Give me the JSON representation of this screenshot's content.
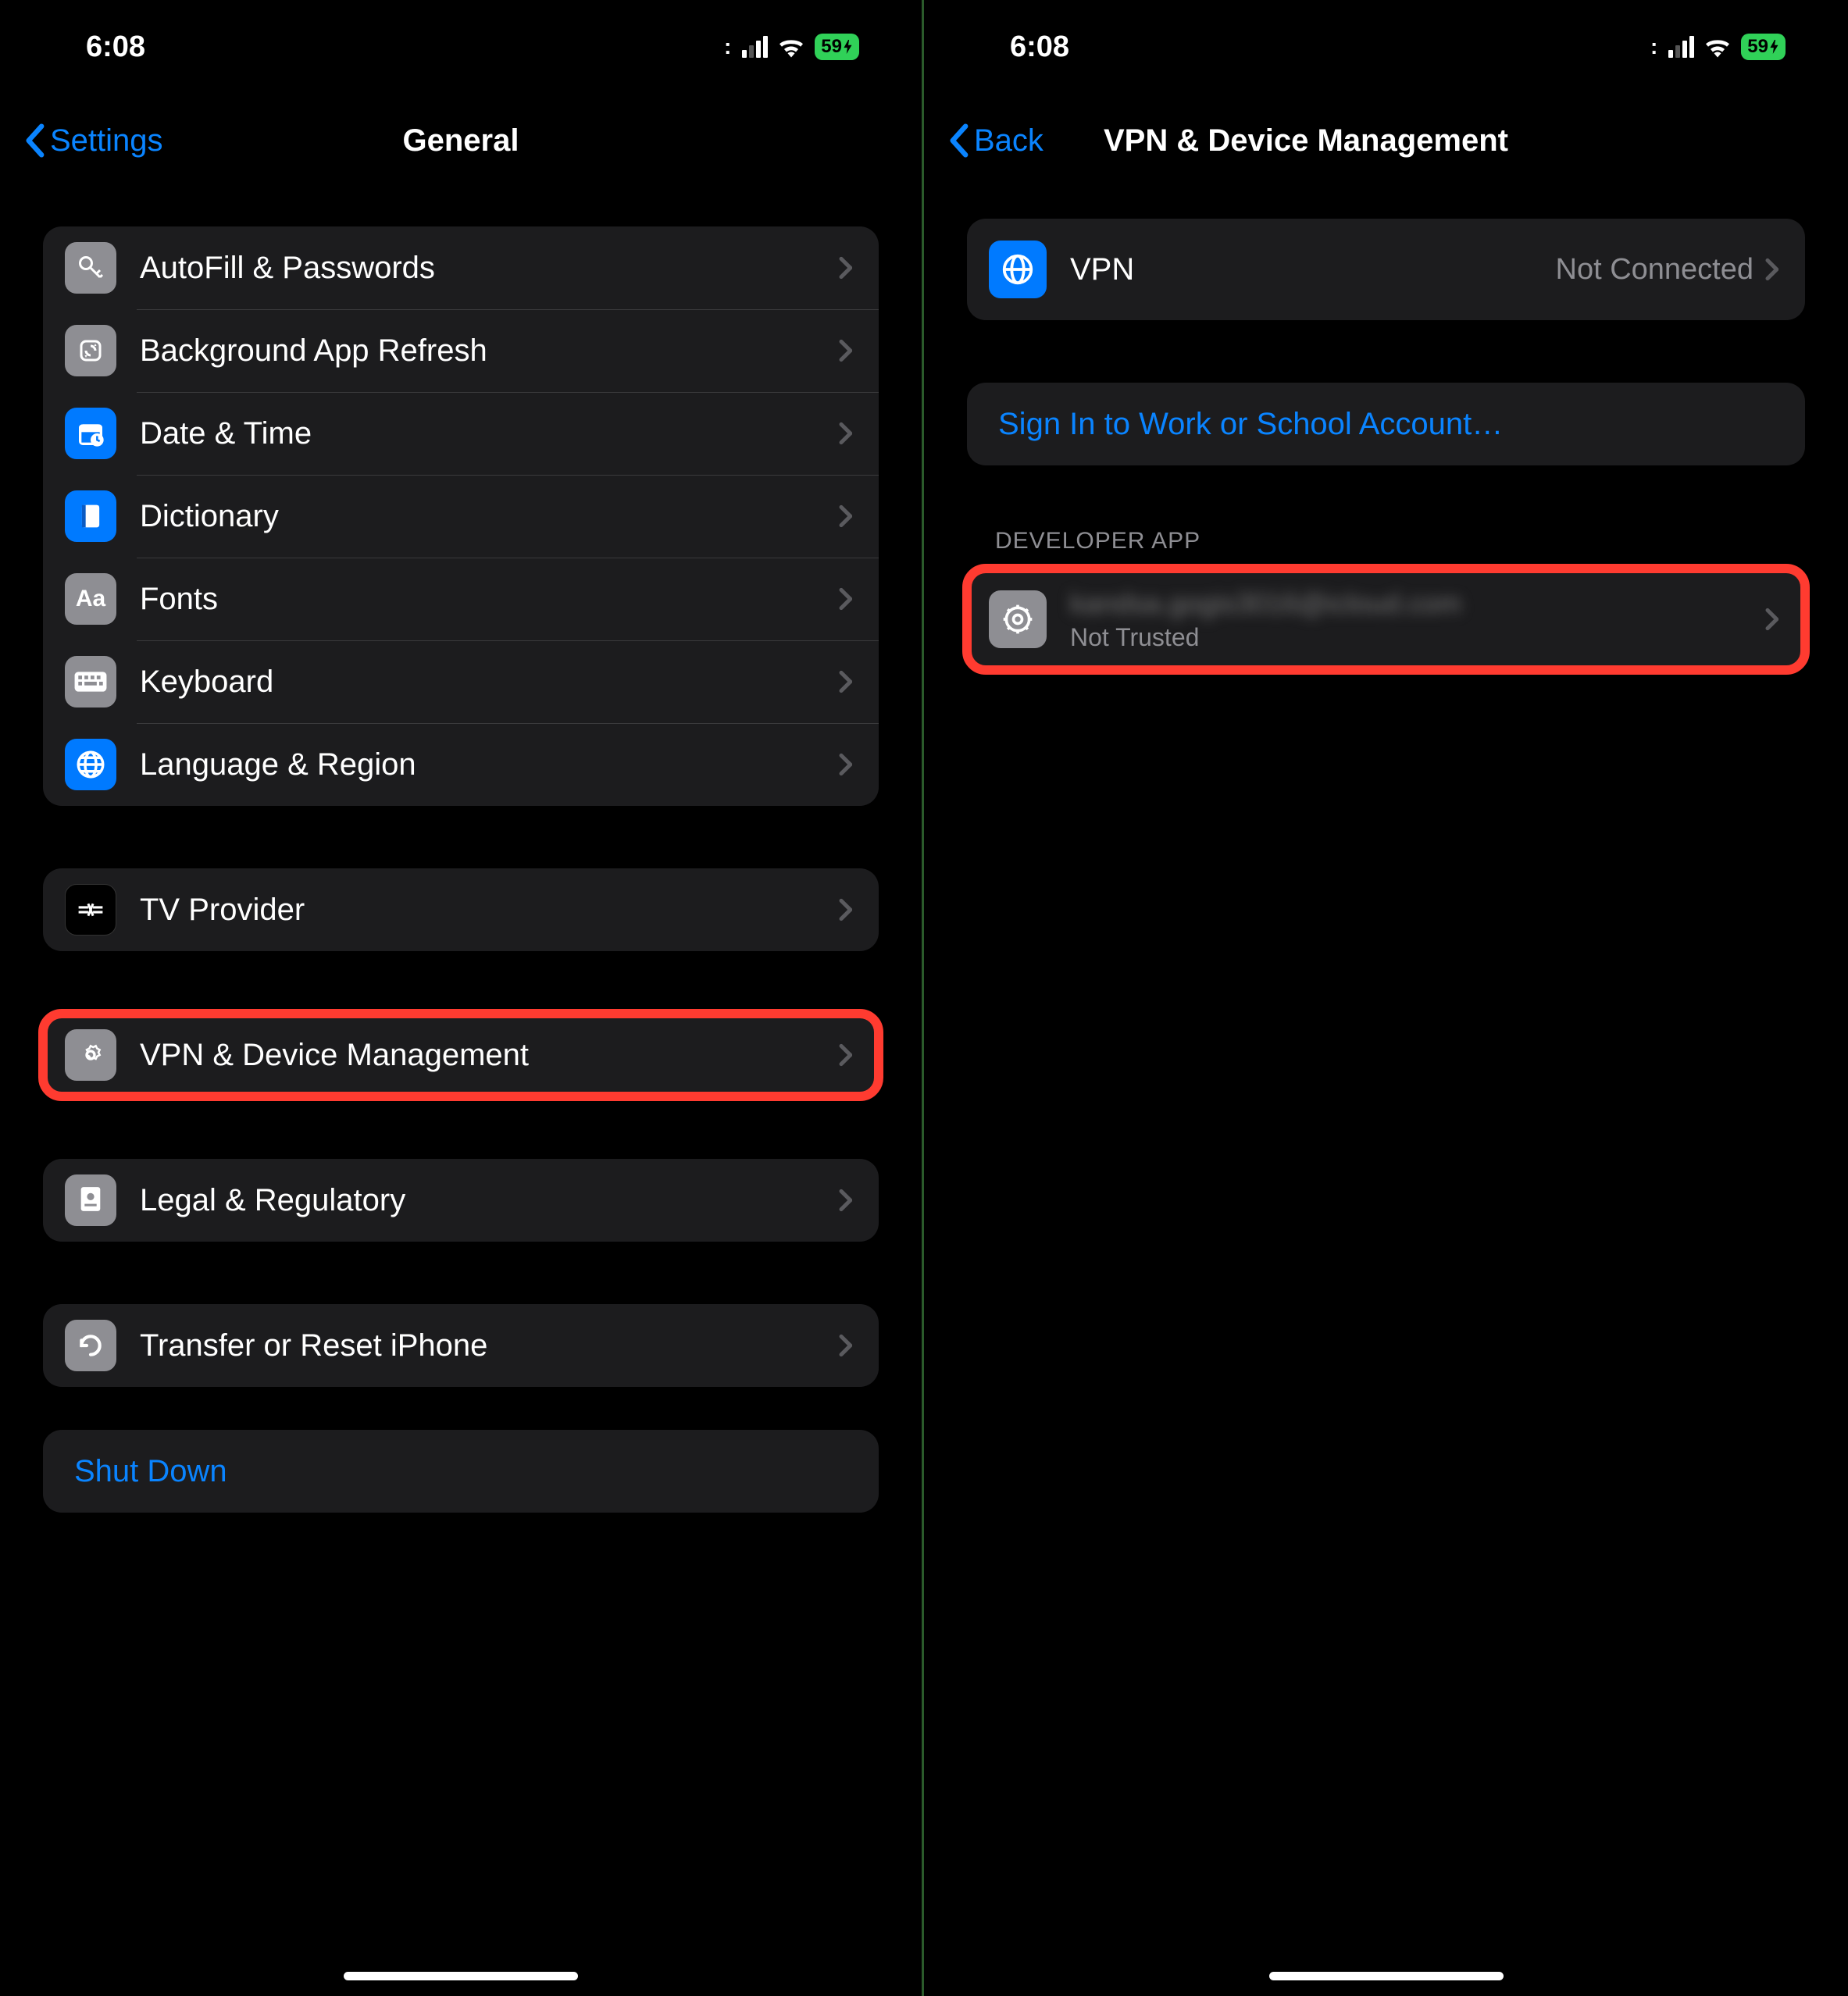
{
  "status": {
    "time": "6:08",
    "battery": "59"
  },
  "left": {
    "back": "Settings",
    "title": "General",
    "rows1": [
      {
        "label": "AutoFill & Passwords"
      },
      {
        "label": "Background App Refresh"
      },
      {
        "label": "Date & Time"
      },
      {
        "label": "Dictionary"
      },
      {
        "label": "Fonts"
      },
      {
        "label": "Keyboard"
      },
      {
        "label": "Language & Region"
      }
    ],
    "tv": "TV Provider",
    "vpn": "VPN & Device Management",
    "legal": "Legal & Regulatory",
    "transfer": "Transfer or Reset iPhone",
    "shutdown": "Shut Down"
  },
  "right": {
    "back": "Back",
    "title": "VPN & Device Management",
    "vpn_label": "VPN",
    "vpn_value": "Not Connected",
    "signin": "Sign In to Work or School Account…",
    "dev_header": "DEVELOPER APP",
    "dev_name": "kandsa.gogis3016@icloud.com",
    "dev_status": "Not Trusted"
  }
}
